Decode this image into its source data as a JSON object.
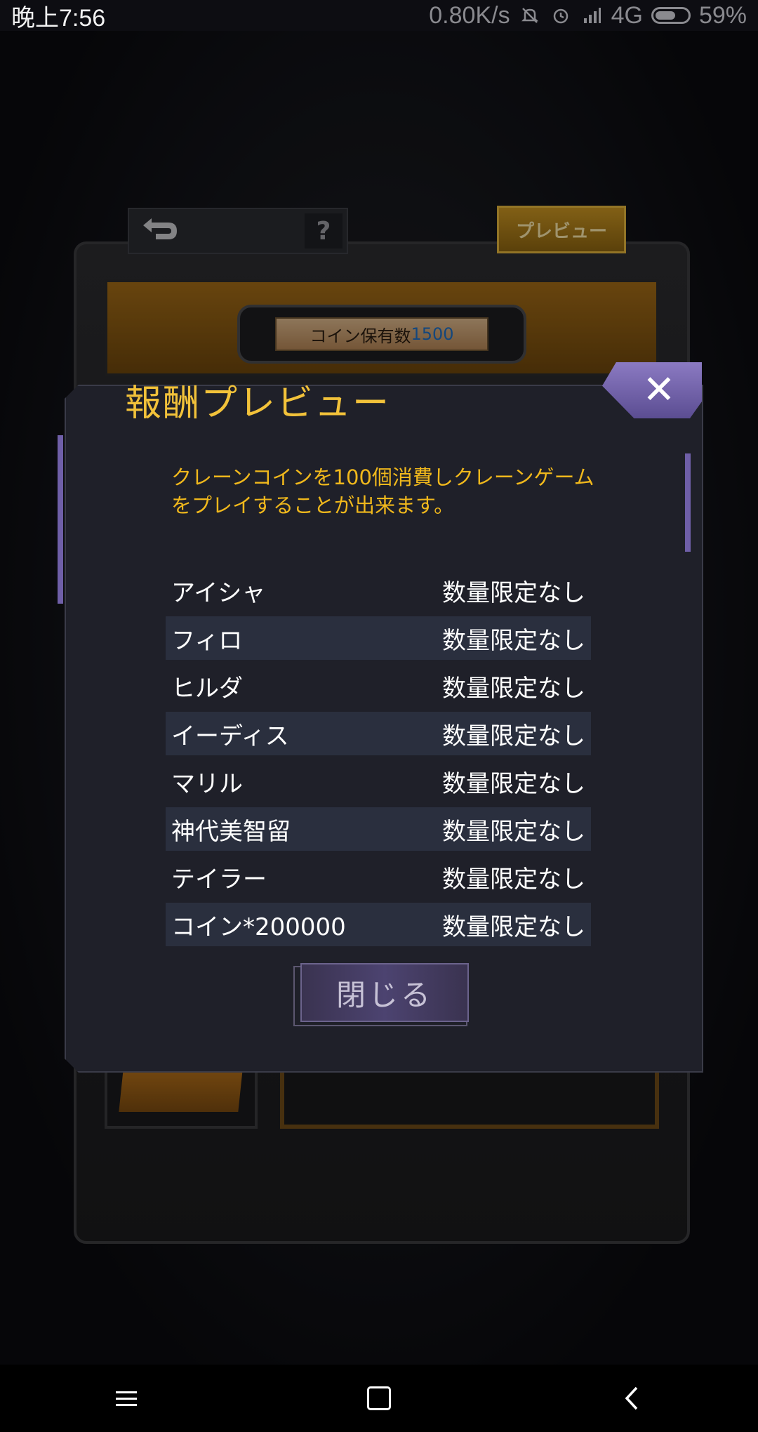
{
  "status_bar": {
    "time": "晚上7:56",
    "net_speed": "0.80K/s",
    "network": "4G",
    "battery": "59%",
    "icons": [
      "mute-bell-icon",
      "alarm-icon",
      "signal-icon",
      "battery-icon"
    ]
  },
  "game": {
    "back_icon": "back-arrow-icon",
    "help_label": "?",
    "preview_button": "プレビュー",
    "coin_label": "コイン保有数",
    "coin_value": "1500"
  },
  "modal": {
    "title": "報酬プレビュー",
    "close_icon": "✕",
    "description": "クレーンコインを100個消費しクレーンゲームをプレイすることが出来ます。",
    "rewards": [
      {
        "name": "アイシャ",
        "limit": "数量限定なし"
      },
      {
        "name": "フィロ",
        "limit": "数量限定なし"
      },
      {
        "name": "ヒルダ",
        "limit": "数量限定なし"
      },
      {
        "name": "イーディス",
        "limit": "数量限定なし"
      },
      {
        "name": "マリル",
        "limit": "数量限定なし"
      },
      {
        "name": "神代美智留",
        "limit": "数量限定なし"
      },
      {
        "name": "テイラー",
        "limit": "数量限定なし"
      },
      {
        "name": "コイン*200000",
        "limit": "数量限定なし"
      }
    ],
    "close_button": "閉じる"
  },
  "colors": {
    "accent_gold": "#f2c23a",
    "desc_orange": "#f0b81c",
    "modal_bg": "#1f2029",
    "close_purple": "#6f5fa8"
  }
}
